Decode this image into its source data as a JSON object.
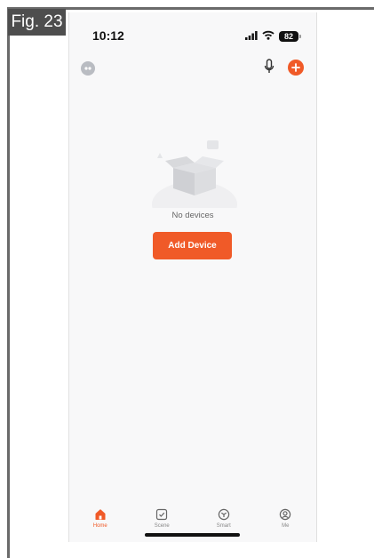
{
  "figure": {
    "label": "Fig. 23"
  },
  "status_bar": {
    "time": "10:12",
    "battery_level": "82"
  },
  "header": {
    "avatar_icon": "avatar-icon",
    "mic_icon": "microphone-icon",
    "add_icon": "plus-icon"
  },
  "empty_state": {
    "message": "No devices",
    "button_label": "Add Device"
  },
  "tab_bar": {
    "tabs": [
      {
        "label": "Home",
        "icon": "home-icon",
        "active": true
      },
      {
        "label": "Scene",
        "icon": "scene-icon",
        "active": false
      },
      {
        "label": "Smart",
        "icon": "smart-icon",
        "active": false
      },
      {
        "label": "Me",
        "icon": "profile-icon",
        "active": false
      }
    ]
  },
  "colors": {
    "accent": "#f05a28",
    "background": "#f8f8f9",
    "figure_tag": "#4e4e4e",
    "inactive": "#888888"
  }
}
